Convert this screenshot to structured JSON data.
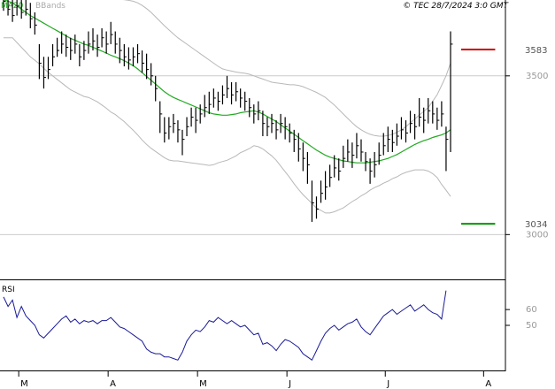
{
  "header": {
    "legend_ma": "MA20",
    "legend_bands": "BBands",
    "copyright": "© TEC 28/7/2024 3:0 GMT"
  },
  "colors": {
    "price": "#000000",
    "ma": "#22aa22",
    "bands": "#b8b8b8",
    "resistance": "#cc0000",
    "support": "#009900",
    "rsi": "#1a1a99",
    "grid": "#cccccc",
    "axis": "#000000",
    "legend_ma": "#22aa22",
    "legend_bands": "#aaaaaa"
  },
  "chart_data": [
    {
      "type": "line",
      "title": "",
      "ylim": [
        2870,
        3700
      ],
      "yticks": [
        3000,
        3500
      ],
      "ytick_labels": [
        "3000",
        "3500"
      ],
      "x_month_labels": [
        "M",
        "A",
        "M",
        "J",
        "J",
        "A"
      ],
      "x_month_index": [
        3,
        23,
        43,
        63,
        85,
        107
      ],
      "x_count": 115,
      "grid": "horizontal",
      "levels": [
        {
          "name": "resistance",
          "value": 3583,
          "label": "3583",
          "from_index": 100,
          "to_index": 108
        },
        {
          "name": "support",
          "value": 3034,
          "label": "3034",
          "from_index": 100,
          "to_index": 108
        }
      ],
      "series": [
        {
          "name": "MA20",
          "kind": "line",
          "values": [
            3740,
            3735,
            3730,
            3720,
            3710,
            3700,
            3690,
            3682,
            3674,
            3666,
            3658,
            3650,
            3642,
            3634,
            3626,
            3618,
            3612,
            3606,
            3600,
            3596,
            3590,
            3584,
            3578,
            3572,
            3565,
            3560,
            3554,
            3548,
            3540,
            3532,
            3522,
            3510,
            3498,
            3486,
            3474,
            3462,
            3450,
            3440,
            3432,
            3426,
            3420,
            3414,
            3408,
            3402,
            3396,
            3390,
            3384,
            3380,
            3378,
            3376,
            3376,
            3378,
            3380,
            3384,
            3386,
            3388,
            3390,
            3386,
            3380,
            3372,
            3364,
            3356,
            3346,
            3336,
            3326,
            3316,
            3306,
            3296,
            3286,
            3276,
            3266,
            3258,
            3250,
            3244,
            3240,
            3236,
            3232,
            3230,
            3228,
            3226,
            3226,
            3226,
            3228,
            3230,
            3232,
            3236,
            3240,
            3246,
            3252,
            3260,
            3268,
            3276,
            3284,
            3290,
            3296,
            3300,
            3306,
            3310,
            3314,
            3320,
            3330
          ]
        },
        {
          "name": "BBands upper",
          "kind": "band",
          "values": [
            3860,
            3850,
            3840,
            3835,
            3830,
            3825,
            3820,
            3815,
            3810,
            3808,
            3805,
            3800,
            3795,
            3790,
            3785,
            3780,
            3775,
            3770,
            3765,
            3760,
            3755,
            3750,
            3748,
            3746,
            3744,
            3742,
            3741,
            3740,
            3738,
            3735,
            3730,
            3722,
            3712,
            3700,
            3686,
            3672,
            3658,
            3645,
            3632,
            3620,
            3610,
            3600,
            3590,
            3580,
            3570,
            3560,
            3550,
            3540,
            3530,
            3522,
            3518,
            3515,
            3512,
            3510,
            3508,
            3505,
            3500,
            3495,
            3490,
            3485,
            3480,
            3478,
            3476,
            3474,
            3472,
            3472,
            3470,
            3466,
            3460,
            3454,
            3448,
            3440,
            3432,
            3420,
            3408,
            3394,
            3380,
            3366,
            3352,
            3340,
            3330,
            3322,
            3316,
            3312,
            3310,
            3310,
            3312,
            3316,
            3322,
            3330,
            3340,
            3352,
            3364,
            3376,
            3388,
            3400,
            3420,
            3440,
            3470,
            3500,
            3540
          ]
        },
        {
          "name": "BBands lower",
          "kind": "band",
          "values": [
            3620,
            3620,
            3620,
            3605,
            3590,
            3575,
            3560,
            3549,
            3538,
            3524,
            3511,
            3500,
            3489,
            3478,
            3467,
            3456,
            3449,
            3442,
            3435,
            3432,
            3425,
            3418,
            3408,
            3398,
            3386,
            3378,
            3367,
            3356,
            3342,
            3329,
            3314,
            3298,
            3284,
            3272,
            3262,
            3252,
            3242,
            3235,
            3232,
            3232,
            3230,
            3228,
            3226,
            3224,
            3222,
            3220,
            3218,
            3220,
            3226,
            3230,
            3234,
            3241,
            3248,
            3258,
            3264,
            3271,
            3280,
            3277,
            3270,
            3259,
            3248,
            3234,
            3216,
            3198,
            3180,
            3160,
            3142,
            3126,
            3112,
            3098,
            3084,
            3076,
            3068,
            3068,
            3072,
            3078,
            3084,
            3094,
            3104,
            3112,
            3122,
            3130,
            3140,
            3148,
            3154,
            3162,
            3168,
            3176,
            3182,
            3190,
            3196,
            3200,
            3204,
            3204,
            3204,
            3200,
            3192,
            3180,
            3158,
            3140,
            3120
          ]
        },
        {
          "name": "Price",
          "kind": "bars",
          "values": [
            [
              3735,
              3790,
              3705
            ],
            [
              3710,
              3760,
              3690
            ],
            [
              3690,
              3740,
              3670
            ],
            [
              3720,
              3770,
              3690
            ],
            [
              3700,
              3750,
              3680
            ],
            [
              3710,
              3755,
              3690
            ],
            [
              3680,
              3730,
              3650
            ],
            [
              3660,
              3700,
              3630
            ],
            [
              3540,
              3600,
              3490
            ],
            [
              3495,
              3560,
              3460
            ],
            [
              3520,
              3560,
              3490
            ],
            [
              3560,
              3600,
              3530
            ],
            [
              3580,
              3620,
              3560
            ],
            [
              3600,
              3640,
              3570
            ],
            [
              3590,
              3630,
              3560
            ],
            [
              3580,
              3620,
              3550
            ],
            [
              3600,
              3630,
              3570
            ],
            [
              3560,
              3600,
              3530
            ],
            [
              3580,
              3610,
              3550
            ],
            [
              3600,
              3640,
              3570
            ],
            [
              3610,
              3650,
              3580
            ],
            [
              3590,
              3630,
              3560
            ],
            [
              3620,
              3650,
              3590
            ],
            [
              3600,
              3640,
              3570
            ],
            [
              3630,
              3670,
              3600
            ],
            [
              3600,
              3640,
              3570
            ],
            [
              3580,
              3620,
              3540
            ],
            [
              3560,
              3600,
              3530
            ],
            [
              3550,
              3590,
              3520
            ],
            [
              3560,
              3590,
              3530
            ],
            [
              3570,
              3600,
              3540
            ],
            [
              3540,
              3580,
              3510
            ],
            [
              3520,
              3570,
              3490
            ],
            [
              3500,
              3540,
              3470
            ],
            [
              3460,
              3500,
              3420
            ],
            [
              3380,
              3420,
              3320
            ],
            [
              3320,
              3370,
              3290
            ],
            [
              3340,
              3370,
              3300
            ],
            [
              3350,
              3380,
              3320
            ],
            [
              3330,
              3360,
              3290
            ],
            [
              3300,
              3330,
              3250
            ],
            [
              3340,
              3370,
              3310
            ],
            [
              3370,
              3400,
              3340
            ],
            [
              3360,
              3400,
              3320
            ],
            [
              3380,
              3410,
              3350
            ],
            [
              3400,
              3440,
              3370
            ],
            [
              3410,
              3450,
              3380
            ],
            [
              3430,
              3460,
              3400
            ],
            [
              3420,
              3450,
              3390
            ],
            [
              3440,
              3470,
              3410
            ],
            [
              3460,
              3500,
              3430
            ],
            [
              3440,
              3480,
              3410
            ],
            [
              3450,
              3480,
              3420
            ],
            [
              3430,
              3460,
              3400
            ],
            [
              3420,
              3450,
              3390
            ],
            [
              3400,
              3430,
              3370
            ],
            [
              3380,
              3410,
              3350
            ],
            [
              3390,
              3420,
              3360
            ],
            [
              3350,
              3390,
              3310
            ],
            [
              3340,
              3370,
              3310
            ],
            [
              3350,
              3380,
              3320
            ],
            [
              3330,
              3360,
              3300
            ],
            [
              3350,
              3380,
              3320
            ],
            [
              3340,
              3370,
              3300
            ],
            [
              3320,
              3350,
              3290
            ],
            [
              3300,
              3330,
              3260
            ],
            [
              3270,
              3320,
              3230
            ],
            [
              3240,
              3290,
              3200
            ],
            [
              3220,
              3260,
              3160
            ],
            [
              3100,
              3170,
              3040
            ],
            [
              3080,
              3120,
              3050
            ],
            [
              3130,
              3170,
              3100
            ],
            [
              3150,
              3200,
              3110
            ],
            [
              3180,
              3220,
              3150
            ],
            [
              3210,
              3250,
              3180
            ],
            [
              3200,
              3240,
              3170
            ],
            [
              3240,
              3280,
              3210
            ],
            [
              3260,
              3300,
              3230
            ],
            [
              3250,
              3290,
              3210
            ],
            [
              3280,
              3320,
              3240
            ],
            [
              3260,
              3300,
              3230
            ],
            [
              3230,
              3260,
              3200
            ],
            [
              3200,
              3240,
              3160
            ],
            [
              3220,
              3260,
              3180
            ],
            [
              3250,
              3290,
              3220
            ],
            [
              3280,
              3320,
              3250
            ],
            [
              3300,
              3340,
              3260
            ],
            [
              3290,
              3330,
              3260
            ],
            [
              3310,
              3350,
              3280
            ],
            [
              3330,
              3370,
              3300
            ],
            [
              3320,
              3360,
              3290
            ],
            [
              3350,
              3390,
              3320
            ],
            [
              3340,
              3380,
              3300
            ],
            [
              3370,
              3430,
              3340
            ],
            [
              3360,
              3400,
              3320
            ],
            [
              3390,
              3430,
              3350
            ],
            [
              3380,
              3420,
              3350
            ],
            [
              3360,
              3400,
              3330
            ],
            [
              3380,
              3420,
              3340
            ],
            [
              3300,
              3340,
              3200
            ],
            [
              3600,
              3640,
              3260
            ]
          ]
        }
      ]
    },
    {
      "type": "line",
      "title": "",
      "label": "RSI",
      "ylim": [
        22,
        78
      ],
      "yticks": [
        50,
        60
      ],
      "ytick_labels": [
        "50",
        "60"
      ],
      "grid": "none",
      "series": [
        {
          "name": "RSI",
          "values": [
            68,
            62,
            66,
            55,
            62,
            56,
            53,
            50,
            44,
            42,
            45,
            48,
            51,
            54,
            56,
            52,
            54,
            51,
            53,
            52,
            53,
            51,
            53,
            53,
            55,
            52,
            49,
            48,
            46,
            44,
            42,
            40,
            35,
            33,
            32,
            32,
            30,
            30,
            29,
            28,
            33,
            40,
            44,
            47,
            46,
            49,
            53,
            52,
            55,
            53,
            51,
            53,
            51,
            49,
            50,
            47,
            44,
            45,
            38,
            39,
            37,
            34,
            38,
            41,
            40,
            38,
            36,
            32,
            30,
            28,
            34,
            40,
            45,
            48,
            50,
            47,
            49,
            51,
            52,
            54,
            49,
            46,
            44,
            48,
            52,
            56,
            58,
            60,
            57,
            59,
            61,
            63,
            59,
            61,
            63,
            60,
            58,
            57,
            54,
            72
          ]
        }
      ]
    }
  ]
}
